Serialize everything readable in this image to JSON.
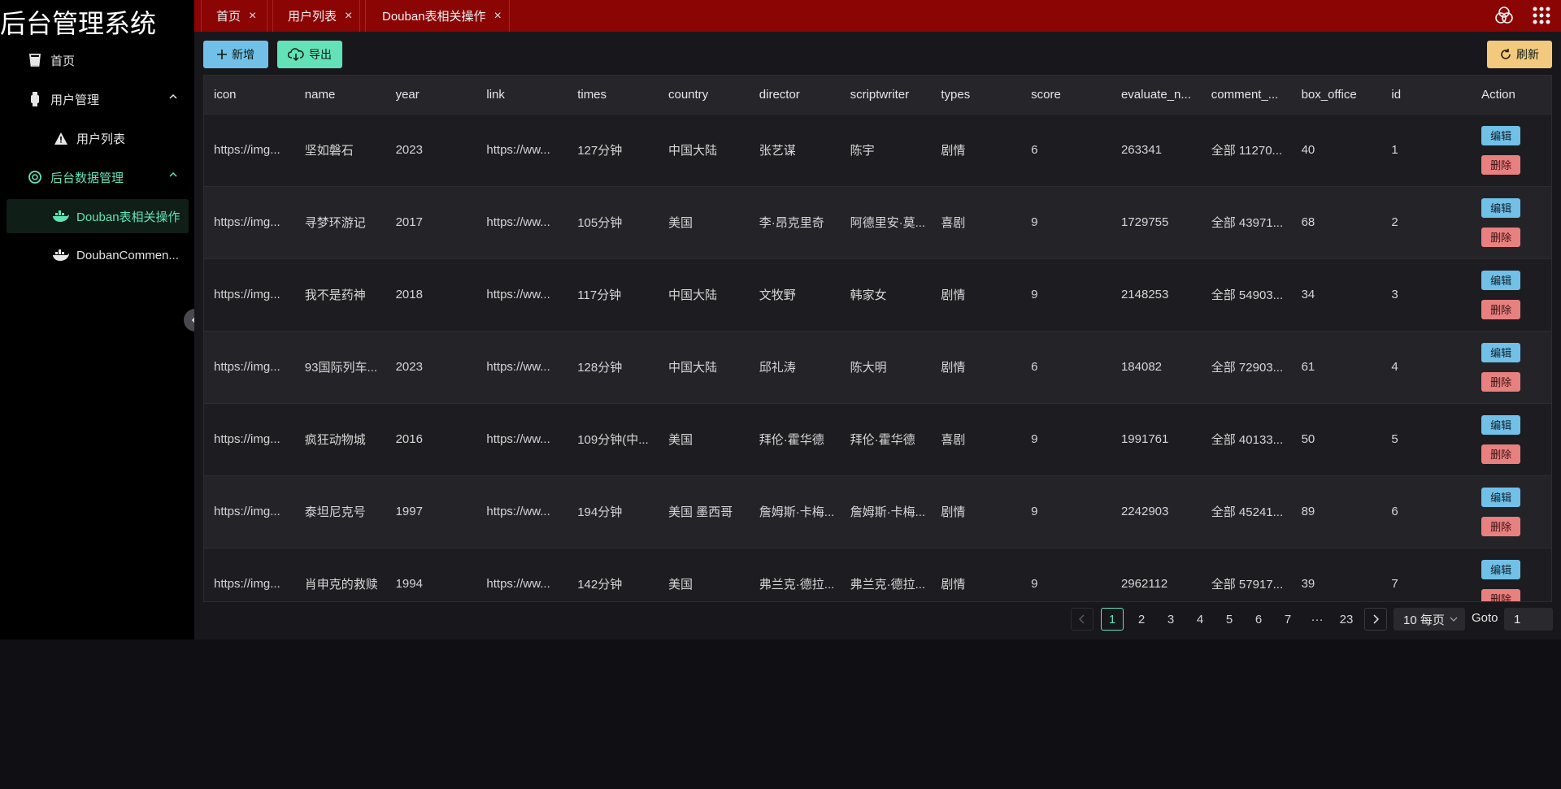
{
  "sidebar": {
    "brand": "后台管理系统",
    "items": [
      {
        "label": "首页"
      },
      {
        "label": "用户管理"
      },
      {
        "label": "用户列表"
      },
      {
        "label": "后台数据管理"
      },
      {
        "label": "Douban表相关操作"
      },
      {
        "label": "DoubanCommen..."
      }
    ]
  },
  "tabs": [
    {
      "label": "首页"
    },
    {
      "label": "用户列表"
    },
    {
      "label": "Douban表相关操作"
    }
  ],
  "toolbar": {
    "add_label": "新增",
    "export_label": "导出",
    "refresh_label": "刷新"
  },
  "table": {
    "columns": [
      "icon",
      "name",
      "year",
      "link",
      "times",
      "country",
      "director",
      "scriptwriter",
      "types",
      "score",
      "evaluate_n...",
      "comment_...",
      "box_office",
      "id",
      "Action"
    ],
    "rows": [
      [
        "https://img...",
        "坚如磐石",
        "2023",
        "https://ww...",
        "127分钟",
        "中国大陆",
        "张艺谋",
        "陈宇",
        "剧情",
        "6",
        "263341",
        "全部 11270...",
        "40",
        "1"
      ],
      [
        "https://img...",
        "寻梦环游记",
        "2017",
        "https://ww...",
        "105分钟",
        "美国",
        "李·昂克里奇",
        "阿德里安·莫...",
        "喜剧",
        "9",
        "1729755",
        "全部 43971...",
        "68",
        "2"
      ],
      [
        "https://img...",
        "我不是药神",
        "2018",
        "https://ww...",
        "117分钟",
        "中国大陆",
        "文牧野",
        "韩家女",
        "剧情",
        "9",
        "2148253",
        "全部 54903...",
        "34",
        "3"
      ],
      [
        "https://img...",
        "93国际列车...",
        "2023",
        "https://ww...",
        "128分钟",
        "中国大陆",
        "邱礼涛",
        "陈大明",
        "剧情",
        "6",
        "184082",
        "全部 72903...",
        "61",
        "4"
      ],
      [
        "https://img...",
        "疯狂动物城",
        "2016",
        "https://ww...",
        "109分钟(中...",
        "美国",
        "拜伦·霍华德",
        "拜伦·霍华德",
        "喜剧",
        "9",
        "1991761",
        "全部 40133...",
        "50",
        "5"
      ],
      [
        "https://img...",
        "泰坦尼克号",
        "1997",
        "https://ww...",
        "194分钟",
        "美国 墨西哥",
        "詹姆斯·卡梅...",
        "詹姆斯·卡梅...",
        "剧情",
        "9",
        "2242903",
        "全部 45241...",
        "89",
        "6"
      ],
      [
        "https://img...",
        "肖申克的救赎",
        "1994",
        "https://ww...",
        "142分钟",
        "美国",
        "弗兰克·德拉...",
        "弗兰克·德拉...",
        "剧情",
        "9",
        "2962112",
        "全部 57917...",
        "39",
        "7"
      ]
    ],
    "edit_label": "编辑",
    "delete_label": "删除"
  },
  "pagination": {
    "pages": [
      "1",
      "2",
      "3",
      "4",
      "5",
      "6",
      "7",
      "···",
      "23"
    ],
    "current": "1",
    "page_size": "10 每页",
    "goto_label": "Goto",
    "goto_value": "1"
  },
  "colors": {
    "topbar": "#8b0505",
    "accent": "#63e2b7",
    "info": "#70c0e8",
    "warning": "#f2c97d",
    "error": "#e88080"
  }
}
